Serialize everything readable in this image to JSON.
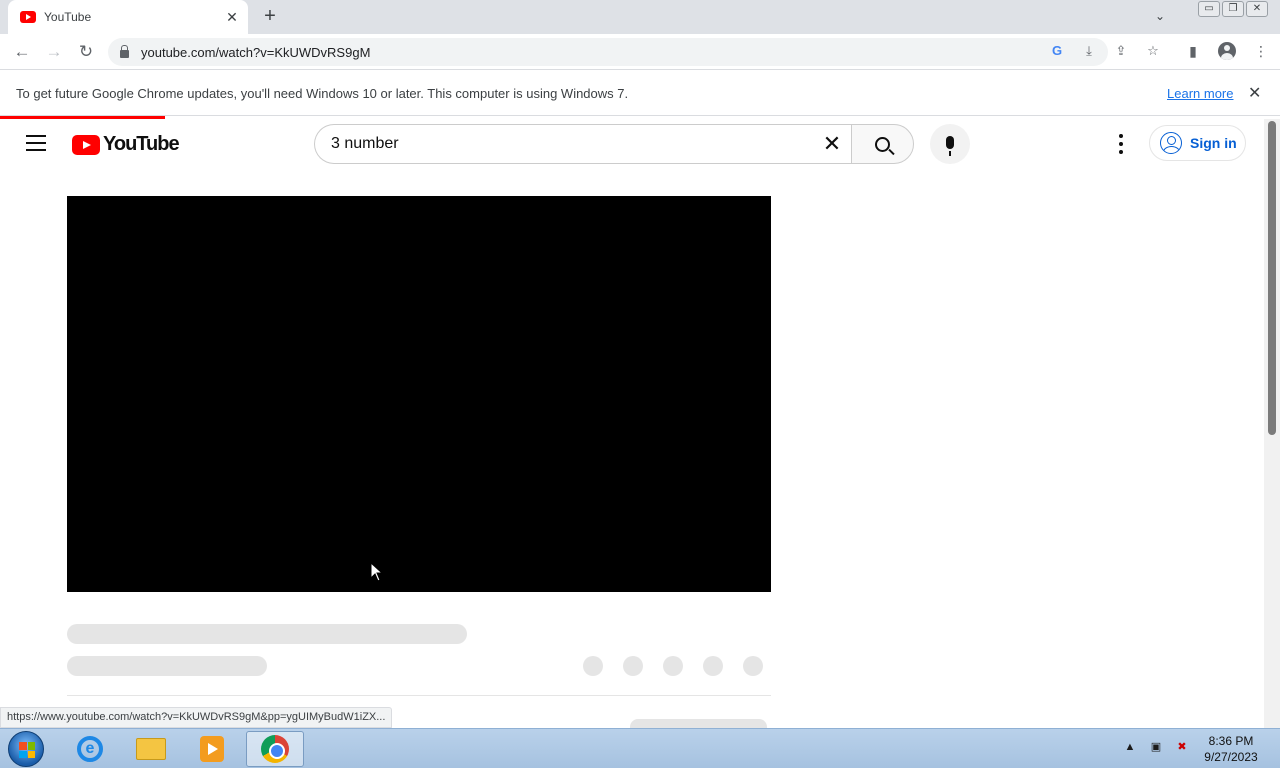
{
  "browser": {
    "tab_title": "YouTube",
    "tab_close": "✕",
    "new_tab": "+",
    "tab_search": "⌄",
    "window_buttons": [
      "▭",
      "❐",
      "✕"
    ],
    "back": "←",
    "forward": "→",
    "reload": "↻",
    "url": "youtube.com/watch?v=KkUWDvRS9gM",
    "status_url": "https://www.youtube.com/watch?v=KkUWDvRS9gM&pp=ygUIMyBudW1iZX..."
  },
  "infobar": {
    "message": "To get future Google Chrome updates, you'll need Windows 10 or later. This computer is using Windows 7.",
    "learn_more": "Learn more",
    "close": "✕"
  },
  "youtube": {
    "logo_text": "YouTube",
    "search_query": "3 number",
    "clear": "✕",
    "signin_label": "Sign in"
  },
  "taskbar": {
    "time": "8:36 PM",
    "date": "9/27/2023",
    "ie_letter": "e"
  },
  "colors": {
    "brand_red": "#ff0000",
    "link_blue": "#065fd4"
  }
}
